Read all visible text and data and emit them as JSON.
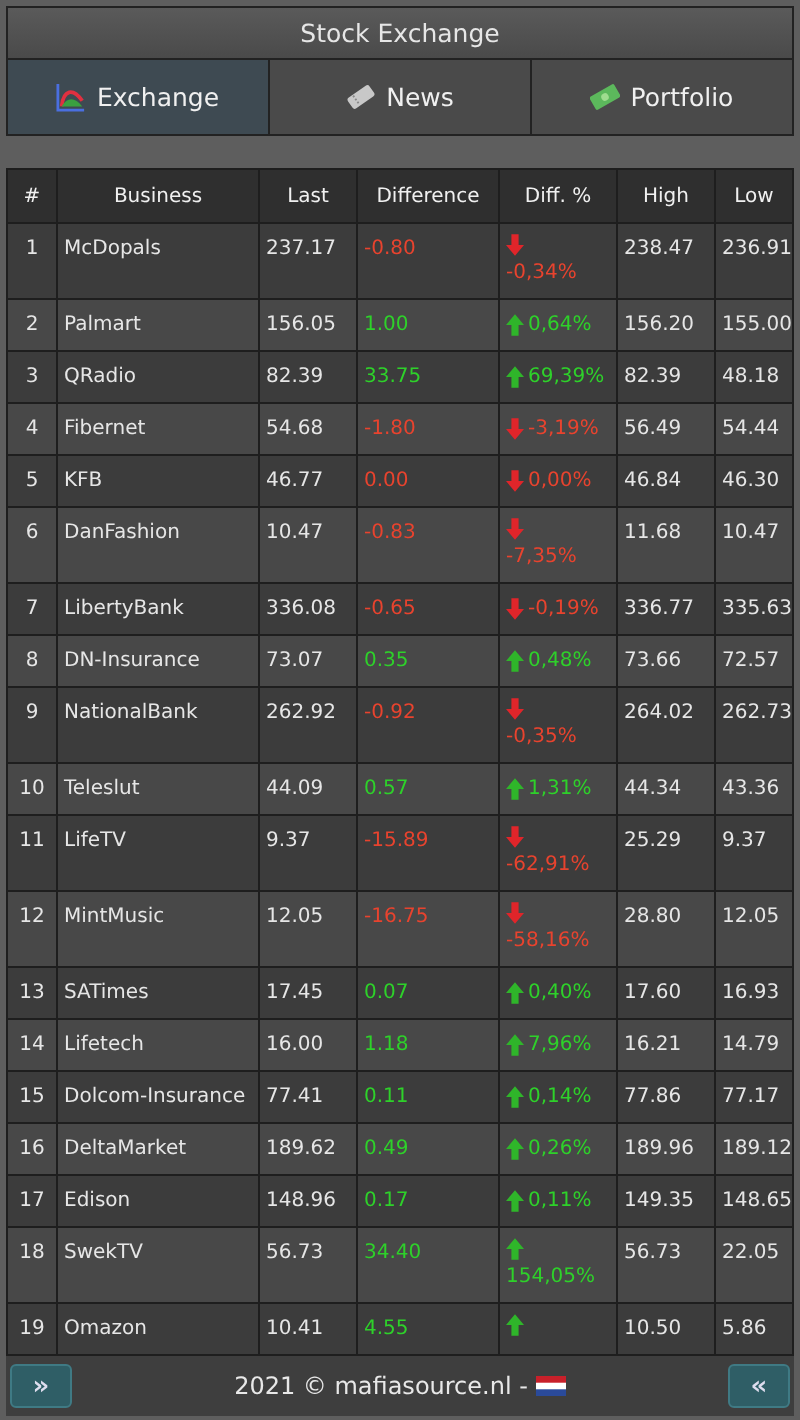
{
  "window": {
    "title": "Stock Exchange"
  },
  "tabs": [
    {
      "label": "Exchange",
      "selected": true
    },
    {
      "label": "News",
      "selected": false
    },
    {
      "label": "Portfolio",
      "selected": false
    }
  ],
  "table": {
    "columns": [
      "#",
      "Business",
      "Last",
      "Difference",
      "Diff. %",
      "High",
      "Low"
    ],
    "rows": [
      {
        "rank": "1",
        "business": "McDopals",
        "last": "237.17",
        "difference": "-0.80",
        "kind": "down",
        "pct": "-0,34%",
        "high": "238.47",
        "low": "236.91"
      },
      {
        "rank": "2",
        "business": "Palmart",
        "last": "156.05",
        "difference": "1.00",
        "kind": "up",
        "pct": "0,64%",
        "high": "156.20",
        "low": "155.00"
      },
      {
        "rank": "3",
        "business": "QRadio",
        "last": "82.39",
        "difference": "33.75",
        "kind": "up",
        "pct": "69,39%",
        "high": "82.39",
        "low": "48.18"
      },
      {
        "rank": "4",
        "business": "Fibernet",
        "last": "54.68",
        "difference": "-1.80",
        "kind": "down",
        "pct": "-3,19%",
        "high": "56.49",
        "low": "54.44"
      },
      {
        "rank": "5",
        "business": "KFB",
        "last": "46.77",
        "difference": "0.00",
        "kind": "down",
        "pct": "0,00%",
        "high": "46.84",
        "low": "46.30"
      },
      {
        "rank": "6",
        "business": "DanFashion",
        "last": "10.47",
        "difference": "-0.83",
        "kind": "down",
        "pct": "-7,35%",
        "high": "11.68",
        "low": "10.47"
      },
      {
        "rank": "7",
        "business": "LibertyBank",
        "last": "336.08",
        "difference": "-0.65",
        "kind": "down",
        "pct": "-0,19%",
        "high": "336.77",
        "low": "335.63"
      },
      {
        "rank": "8",
        "business": "DN-Insurance",
        "last": "73.07",
        "difference": "0.35",
        "kind": "up",
        "pct": "0,48%",
        "high": "73.66",
        "low": "72.57"
      },
      {
        "rank": "9",
        "business": "NationalBank",
        "last": "262.92",
        "difference": "-0.92",
        "kind": "down",
        "pct": "-0,35%",
        "high": "264.02",
        "low": "262.73"
      },
      {
        "rank": "10",
        "business": "Teleslut",
        "last": "44.09",
        "difference": "0.57",
        "kind": "up",
        "pct": "1,31%",
        "high": "44.34",
        "low": "43.36"
      },
      {
        "rank": "11",
        "business": "LifeTV",
        "last": "9.37",
        "difference": "-15.89",
        "kind": "down",
        "pct": "-62,91%",
        "high": "25.29",
        "low": "9.37"
      },
      {
        "rank": "12",
        "business": "MintMusic",
        "last": "12.05",
        "difference": "-16.75",
        "kind": "down",
        "pct": "-58,16%",
        "high": "28.80",
        "low": "12.05"
      },
      {
        "rank": "13",
        "business": "SATimes",
        "last": "17.45",
        "difference": "0.07",
        "kind": "up",
        "pct": "0,40%",
        "high": "17.60",
        "low": "16.93"
      },
      {
        "rank": "14",
        "business": "Lifetech",
        "last": "16.00",
        "difference": "1.18",
        "kind": "up",
        "pct": "7,96%",
        "high": "16.21",
        "low": "14.79"
      },
      {
        "rank": "15",
        "business": "Dolcom-Insurance",
        "last": "77.41",
        "difference": "0.11",
        "kind": "up",
        "pct": "0,14%",
        "high": "77.86",
        "low": "77.17"
      },
      {
        "rank": "16",
        "business": "DeltaMarket",
        "last": "189.62",
        "difference": "0.49",
        "kind": "up",
        "pct": "0,26%",
        "high": "189.96",
        "low": "189.12"
      },
      {
        "rank": "17",
        "business": "Edison",
        "last": "148.96",
        "difference": "0.17",
        "kind": "up",
        "pct": "0,11%",
        "high": "149.35",
        "low": "148.65"
      },
      {
        "rank": "18",
        "business": "SwekTV",
        "last": "56.73",
        "difference": "34.40",
        "kind": "up",
        "pct": "154,05%",
        "high": "56.73",
        "low": "22.05"
      },
      {
        "rank": "19",
        "business": "Omazon",
        "last": "10.41",
        "difference": "4.55",
        "kind": "up",
        "high": "10.50",
        "low": "5.86"
      }
    ]
  },
  "footer": {
    "prev": "»",
    "text": "2021 © mafiasource.nl -",
    "next": "«"
  }
}
